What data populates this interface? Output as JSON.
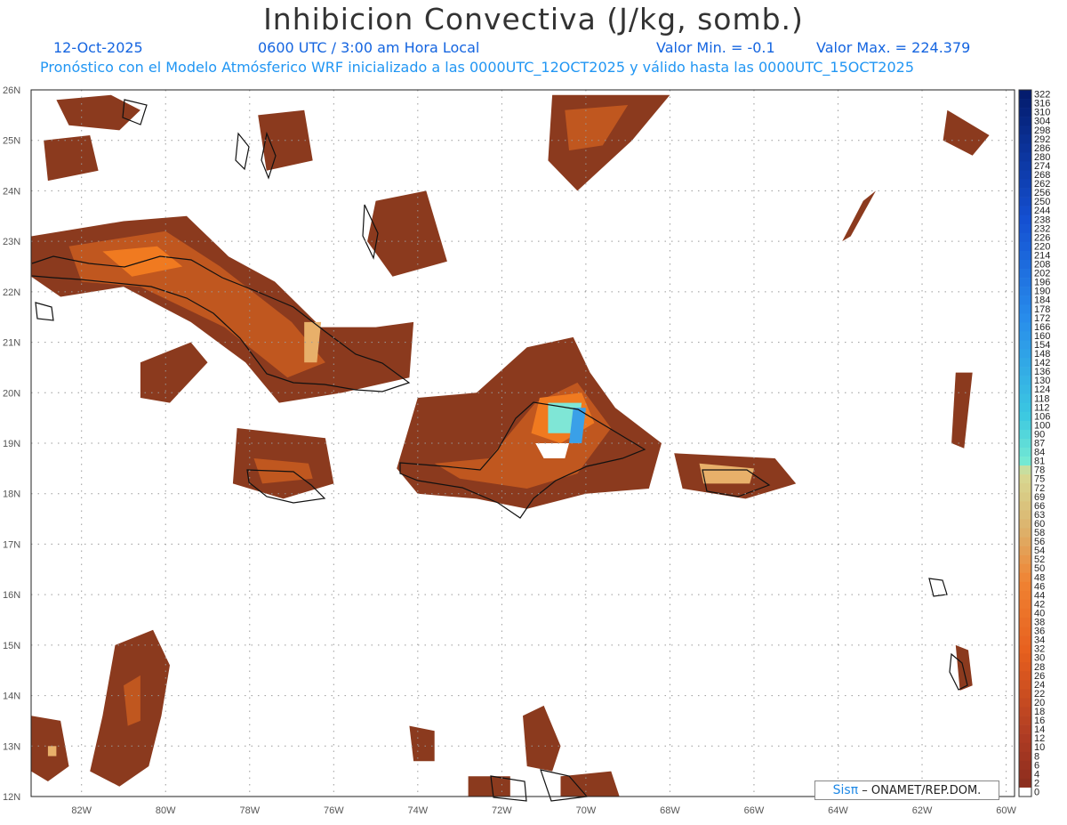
{
  "header": {
    "title": "Inhibicion Convectiva (J/kg, somb.)",
    "date": "12-Oct-2025",
    "time": "0600 UTC / 3:00 am Hora Local",
    "valor_min": "Valor Min. = -0.1",
    "valor_max": "Valor Max. = 224.379",
    "forecast": "Pronóstico con el Modelo Atmósferico WRF inicializado a las 0000UTC_12OCT2025 y válido hasta las  0000UTC_15OCT2025"
  },
  "credit": {
    "brand": "Sisπ",
    "text": "– ONAMET/REP.DOM."
  },
  "axes": {
    "lon_labels": [
      "82W",
      "80W",
      "78W",
      "76W",
      "74W",
      "72W",
      "70W",
      "68W",
      "66W",
      "64W",
      "62W",
      "60W"
    ],
    "lat_labels": [
      "26N",
      "25N",
      "24N",
      "23N",
      "22N",
      "21N",
      "20N",
      "19N",
      "18N",
      "17N",
      "16N",
      "15N",
      "14N",
      "13N",
      "12N"
    ]
  },
  "colorbar": {
    "labels": [
      "322",
      "316",
      "310",
      "304",
      "298",
      "292",
      "286",
      "280",
      "274",
      "268",
      "262",
      "256",
      "250",
      "244",
      "238",
      "232",
      "226",
      "220",
      "214",
      "208",
      "202",
      "196",
      "190",
      "184",
      "178",
      "172",
      "166",
      "160",
      "154",
      "148",
      "142",
      "136",
      "130",
      "124",
      "118",
      "112",
      "106",
      "100",
      "90",
      "87",
      "84",
      "81",
      "78",
      "75",
      "72",
      "69",
      "66",
      "63",
      "60",
      "58",
      "56",
      "54",
      "52",
      "50",
      "48",
      "46",
      "44",
      "42",
      "40",
      "38",
      "36",
      "34",
      "32",
      "30",
      "28",
      "26",
      "24",
      "22",
      "20",
      "18",
      "16",
      "14",
      "12",
      "10",
      "8",
      "6",
      "4",
      "2",
      "0"
    ]
  },
  "colors": {
    "field_base": "#8b3a1e",
    "field_mid": "#c0571f",
    "field_high": "#f07a20",
    "field_peak": "#dccf8a",
    "field_cyan": "#7fe6d6",
    "field_blue": "#3aa0e8"
  },
  "map_data": {
    "extent": {
      "lon": [
        -83.2,
        -59.8
      ],
      "lat": [
        12,
        26
      ]
    },
    "blobs": [
      {
        "c": "#8b3a1e",
        "pts": [
          [
            -82.6,
            25.8
          ],
          [
            -81.3,
            25.9
          ],
          [
            -80.6,
            25.6
          ],
          [
            -81.1,
            25.2
          ],
          [
            -82.3,
            25.3
          ]
        ]
      },
      {
        "c": "#8b3a1e",
        "pts": [
          [
            -82.9,
            25.0
          ],
          [
            -81.8,
            25.1
          ],
          [
            -81.6,
            24.4
          ],
          [
            -82.8,
            24.2
          ]
        ]
      },
      {
        "c": "#8b3a1e",
        "pts": [
          [
            -77.8,
            25.5
          ],
          [
            -76.7,
            25.6
          ],
          [
            -76.5,
            24.6
          ],
          [
            -77.6,
            24.4
          ]
        ]
      },
      {
        "c": "#8b3a1e",
        "pts": [
          [
            -75.0,
            23.8
          ],
          [
            -73.8,
            24.0
          ],
          [
            -73.3,
            22.6
          ],
          [
            -74.6,
            22.3
          ],
          [
            -75.2,
            23.0
          ]
        ]
      },
      {
        "c": "#8b3a1e",
        "pts": [
          [
            -70.8,
            25.9
          ],
          [
            -68.0,
            25.9
          ],
          [
            -68.9,
            25.0
          ],
          [
            -70.2,
            24.0
          ],
          [
            -70.9,
            24.6
          ]
        ]
      },
      {
        "c": "#c0571f",
        "pts": [
          [
            -70.5,
            25.6
          ],
          [
            -69.0,
            25.7
          ],
          [
            -69.6,
            24.9
          ],
          [
            -70.4,
            24.8
          ]
        ]
      },
      {
        "c": "#8b3a1e",
        "pts": [
          [
            -83.2,
            23.1
          ],
          [
            -81.0,
            23.4
          ],
          [
            -79.5,
            23.5
          ],
          [
            -78.5,
            22.7
          ],
          [
            -77.4,
            22.2
          ],
          [
            -76.3,
            21.3
          ],
          [
            -75.0,
            21.3
          ],
          [
            -74.1,
            21.4
          ],
          [
            -74.2,
            20.3
          ],
          [
            -75.8,
            20.0
          ],
          [
            -77.3,
            19.8
          ],
          [
            -78.1,
            20.6
          ],
          [
            -79.4,
            21.4
          ],
          [
            -81.0,
            22.1
          ],
          [
            -82.5,
            21.9
          ],
          [
            -83.2,
            22.3
          ]
        ]
      },
      {
        "c": "#c0571f",
        "pts": [
          [
            -82.3,
            22.9
          ],
          [
            -80.0,
            23.2
          ],
          [
            -78.7,
            22.5
          ],
          [
            -77.0,
            21.4
          ],
          [
            -76.2,
            20.6
          ],
          [
            -77.1,
            20.3
          ],
          [
            -78.6,
            21.3
          ],
          [
            -80.6,
            22.1
          ],
          [
            -82.0,
            22.2
          ]
        ]
      },
      {
        "c": "#f07a20",
        "pts": [
          [
            -81.5,
            22.8
          ],
          [
            -80.2,
            22.9
          ],
          [
            -79.6,
            22.5
          ],
          [
            -80.8,
            22.3
          ]
        ]
      },
      {
        "c": "#e8b06a",
        "pts": [
          [
            -76.7,
            21.4
          ],
          [
            -76.3,
            21.4
          ],
          [
            -76.4,
            20.6
          ],
          [
            -76.7,
            20.6
          ]
        ]
      },
      {
        "c": "#8b3a1e",
        "pts": [
          [
            -78.3,
            19.3
          ],
          [
            -76.2,
            19.1
          ],
          [
            -76.0,
            18.2
          ],
          [
            -77.2,
            17.9
          ],
          [
            -78.4,
            18.2
          ]
        ]
      },
      {
        "c": "#c0571f",
        "pts": [
          [
            -77.9,
            18.7
          ],
          [
            -76.6,
            18.6
          ],
          [
            -76.5,
            18.3
          ],
          [
            -77.7,
            18.2
          ]
        ]
      },
      {
        "c": "#8b3a1e",
        "pts": [
          [
            -74.0,
            19.9
          ],
          [
            -72.6,
            20.0
          ],
          [
            -71.4,
            20.9
          ],
          [
            -70.3,
            21.1
          ],
          [
            -69.9,
            20.4
          ],
          [
            -69.3,
            19.7
          ],
          [
            -68.2,
            19.0
          ],
          [
            -68.5,
            18.1
          ],
          [
            -70.0,
            18.0
          ],
          [
            -71.4,
            17.7
          ],
          [
            -72.6,
            17.9
          ],
          [
            -74.0,
            18.0
          ],
          [
            -74.5,
            18.5
          ]
        ]
      },
      {
        "c": "#c0571f",
        "pts": [
          [
            -73.6,
            18.6
          ],
          [
            -72.3,
            18.7
          ],
          [
            -71.2,
            19.8
          ],
          [
            -70.2,
            20.2
          ],
          [
            -69.4,
            19.3
          ],
          [
            -70.2,
            18.4
          ],
          [
            -71.4,
            18.1
          ],
          [
            -73.0,
            18.3
          ]
        ]
      },
      {
        "c": "#f07a20",
        "pts": [
          [
            -71.1,
            19.9
          ],
          [
            -70.1,
            20.0
          ],
          [
            -69.8,
            19.4
          ],
          [
            -70.6,
            19.0
          ],
          [
            -71.3,
            19.2
          ]
        ]
      },
      {
        "c": "#7fe6d6",
        "pts": [
          [
            -70.9,
            19.8
          ],
          [
            -70.1,
            19.8
          ],
          [
            -70.2,
            19.2
          ],
          [
            -70.9,
            19.2
          ]
        ]
      },
      {
        "c": "#3aa0e8",
        "pts": [
          [
            -70.3,
            19.7
          ],
          [
            -70.0,
            19.7
          ],
          [
            -70.1,
            19.0
          ],
          [
            -70.4,
            19.0
          ]
        ]
      },
      {
        "c": "#ffffff",
        "pts": [
          [
            -71.2,
            19.0
          ],
          [
            -70.4,
            19.0
          ],
          [
            -70.5,
            18.7
          ],
          [
            -71.0,
            18.7
          ]
        ]
      },
      {
        "c": "#8b3a1e",
        "pts": [
          [
            -67.9,
            18.8
          ],
          [
            -65.5,
            18.7
          ],
          [
            -65.0,
            18.2
          ],
          [
            -66.2,
            17.9
          ],
          [
            -67.7,
            18.1
          ]
        ]
      },
      {
        "c": "#e8b06a",
        "pts": [
          [
            -67.3,
            18.6
          ],
          [
            -66.0,
            18.5
          ],
          [
            -66.1,
            18.2
          ],
          [
            -67.2,
            18.2
          ]
        ]
      },
      {
        "c": "#8b3a1e",
        "pts": [
          [
            -80.6,
            20.6
          ],
          [
            -79.4,
            21.0
          ],
          [
            -79.0,
            20.6
          ],
          [
            -79.9,
            19.8
          ],
          [
            -80.6,
            19.9
          ]
        ]
      },
      {
        "c": "#8b3a1e",
        "pts": [
          [
            -81.2,
            15.0
          ],
          [
            -80.3,
            15.3
          ],
          [
            -79.9,
            14.6
          ],
          [
            -80.1,
            13.6
          ],
          [
            -80.4,
            12.6
          ],
          [
            -81.1,
            12.2
          ],
          [
            -81.8,
            12.5
          ],
          [
            -81.5,
            13.6
          ]
        ]
      },
      {
        "c": "#c0571f",
        "pts": [
          [
            -81.0,
            14.2
          ],
          [
            -80.6,
            14.4
          ],
          [
            -80.6,
            13.5
          ],
          [
            -80.9,
            13.4
          ]
        ]
      },
      {
        "c": "#8b3a1e",
        "pts": [
          [
            -83.2,
            13.6
          ],
          [
            -82.5,
            13.5
          ],
          [
            -82.3,
            12.6
          ],
          [
            -82.8,
            12.3
          ],
          [
            -83.2,
            12.5
          ]
        ]
      },
      {
        "c": "#e8b06a",
        "pts": [
          [
            -82.8,
            13.0
          ],
          [
            -82.6,
            13.0
          ],
          [
            -82.6,
            12.8
          ],
          [
            -82.8,
            12.8
          ]
        ]
      },
      {
        "c": "#8b3a1e",
        "pts": [
          [
            -71.5,
            13.6
          ],
          [
            -71.0,
            13.8
          ],
          [
            -70.6,
            13.0
          ],
          [
            -70.8,
            12.5
          ],
          [
            -71.4,
            12.6
          ]
        ]
      },
      {
        "c": "#8b3a1e",
        "pts": [
          [
            -63.4,
            23.8
          ],
          [
            -63.1,
            24.0
          ],
          [
            -63.7,
            23.1
          ],
          [
            -63.9,
            23.0
          ]
        ]
      },
      {
        "c": "#8b3a1e",
        "pts": [
          [
            -61.4,
            25.6
          ],
          [
            -60.4,
            25.1
          ],
          [
            -60.8,
            24.7
          ],
          [
            -61.5,
            25.0
          ]
        ]
      },
      {
        "c": "#8b3a1e",
        "pts": [
          [
            -61.2,
            20.4
          ],
          [
            -60.8,
            20.4
          ],
          [
            -61.0,
            18.9
          ],
          [
            -61.3,
            19.0
          ]
        ]
      },
      {
        "c": "#8b3a1e",
        "pts": [
          [
            -61.2,
            15.0
          ],
          [
            -60.9,
            14.9
          ],
          [
            -60.8,
            14.2
          ],
          [
            -61.1,
            14.1
          ]
        ]
      },
      {
        "c": "#8b3a1e",
        "pts": [
          [
            -74.2,
            13.4
          ],
          [
            -73.6,
            13.3
          ],
          [
            -73.6,
            12.7
          ],
          [
            -74.1,
            12.7
          ]
        ]
      },
      {
        "c": "#8b3a1e",
        "pts": [
          [
            -70.6,
            12.4
          ],
          [
            -69.4,
            12.5
          ],
          [
            -69.2,
            12.0
          ],
          [
            -70.6,
            12.0
          ]
        ]
      },
      {
        "c": "#8b3a1e",
        "pts": [
          [
            -72.8,
            12.4
          ],
          [
            -71.8,
            12.4
          ],
          [
            -71.8,
            12.0
          ],
          [
            -72.8,
            12.0
          ]
        ]
      }
    ]
  }
}
